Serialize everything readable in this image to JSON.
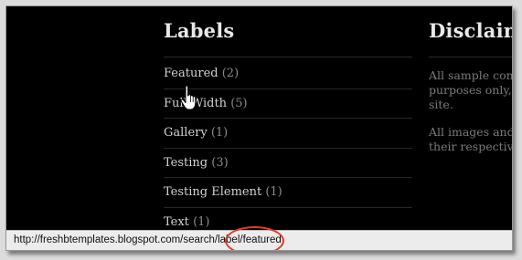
{
  "labels_widget": {
    "title": "Labels",
    "items": [
      {
        "label": "Featured",
        "count": "(2)"
      },
      {
        "label": "Full Width",
        "count": "(5)"
      },
      {
        "label": "Gallery",
        "count": "(1)"
      },
      {
        "label": "Testing",
        "count": "(3)"
      },
      {
        "label": "Testing Element",
        "count": "(1)"
      },
      {
        "label": "Text",
        "count": "(1)"
      }
    ]
  },
  "disclaimer_widget": {
    "title": "Disclaime",
    "paragraph1": "All sample con purposes only, site.",
    "paragraph1_lines": [
      "All sample con",
      "purposes only,",
      "site."
    ],
    "paragraph2_lines": [
      "All images and",
      "their respective"
    ]
  },
  "status_bar": {
    "url": "http://freshbtemplates.blogspot.com/search/label/featured"
  },
  "colors": {
    "page_background": "#000000",
    "highlight_circle": "#e23a2a"
  },
  "icons": {
    "cursor": "hand-pointer-icon"
  }
}
